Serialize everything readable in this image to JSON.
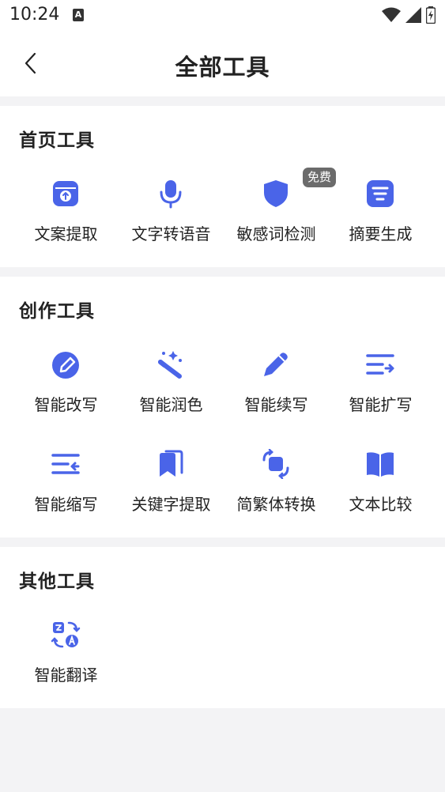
{
  "status_bar": {
    "time": "10:24",
    "a_icon_label": "A"
  },
  "header": {
    "title": "全部工具"
  },
  "colors": {
    "accent": "#4a64e8",
    "badge": "#6b6b6b"
  },
  "sections": [
    {
      "title": "首页工具",
      "tools": [
        {
          "label": "文案提取",
          "icon": "upload-box-icon"
        },
        {
          "label": "文字转语音",
          "icon": "microphone-icon"
        },
        {
          "label": "敏感词检测",
          "icon": "shield-icon",
          "badge": "免费"
        },
        {
          "label": "摘要生成",
          "icon": "summary-list-icon"
        }
      ]
    },
    {
      "title": "创作工具",
      "tools": [
        {
          "label": "智能改写",
          "icon": "edit-circle-icon"
        },
        {
          "label": "智能润色",
          "icon": "magic-wand-icon"
        },
        {
          "label": "智能续写",
          "icon": "pen-icon"
        },
        {
          "label": "智能扩写",
          "icon": "expand-lines-icon"
        },
        {
          "label": "智能缩写",
          "icon": "shrink-lines-icon"
        },
        {
          "label": "关键字提取",
          "icon": "bookmarks-icon"
        },
        {
          "label": "简繁体转换",
          "icon": "convert-icon"
        },
        {
          "label": "文本比较",
          "icon": "book-icon"
        }
      ]
    },
    {
      "title": "其他工具",
      "tools": [
        {
          "label": "智能翻译",
          "icon": "translate-icon"
        }
      ]
    }
  ]
}
